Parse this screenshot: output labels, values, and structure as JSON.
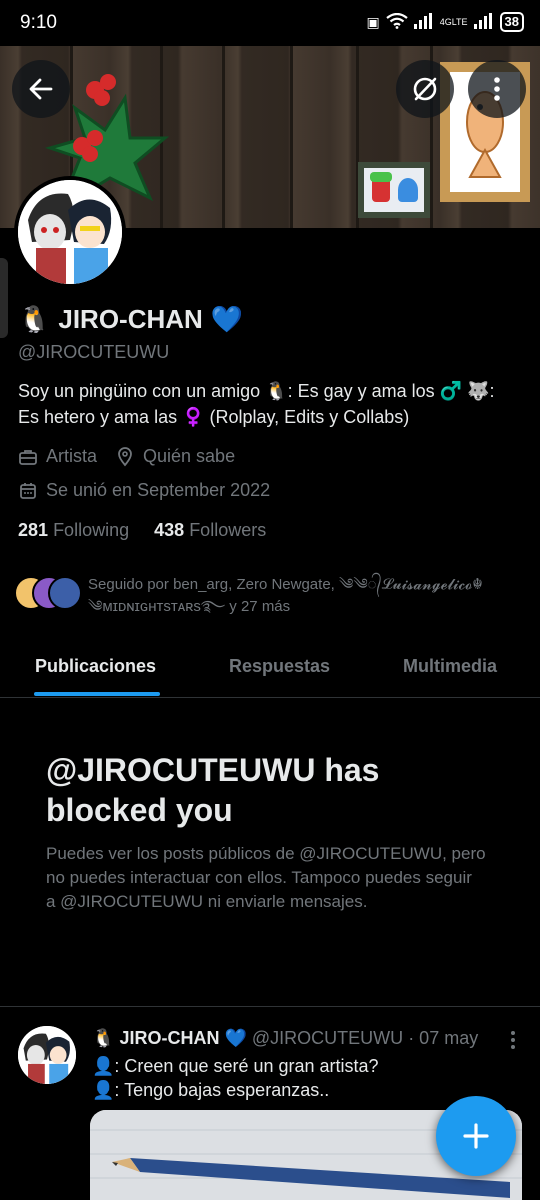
{
  "status_bar": {
    "time": "9:10",
    "network": "4GLTE",
    "battery": "38"
  },
  "profile": {
    "display_name": "JIRO-CHAN",
    "name_prefix_emoji": "🐧",
    "name_suffix_emoji": "💙",
    "handle": "@JIROCUTEUWU",
    "bio": "Soy un pingüino con un amigo 🐧: Es gay y ama los ♂️ 🐺: Es hetero y ama las ♀️ (Rolplay, Edits y Collabs)",
    "occupation": "Artista",
    "location": "Quién sabe",
    "joined": "Se unió en September 2022",
    "following_count": "281",
    "following_label": "Following",
    "followers_count": "438",
    "followers_label": "Followers",
    "followed_by": "Seguido por ben_arg, Zero Newgate, ༄༄᭄𝓛𝓾𝓲𝓼𝓪𝓷𝓰𝓮𝓵𝓲𝓬𝓸☬ ༄ᴍɪᴅɴɪɢʜᴛsᴛᴀʀs࿐ y 27 más"
  },
  "tabs": [
    {
      "label": "Publicaciones",
      "active": true
    },
    {
      "label": "Respuestas",
      "active": false
    },
    {
      "label": "Multimedia",
      "active": false
    }
  ],
  "blocked": {
    "title": "@JIROCUTEUWU has blocked you",
    "description": "Puedes ver los posts públicos de @JIROCUTEUWU, pero no puedes interactuar con ellos. Tampoco puedes seguir a @JIROCUTEUWU ni enviarle mensajes."
  },
  "post": {
    "author_emoji": "🐧",
    "author": "JIRO-CHAN",
    "author_suffix": "💙",
    "handle": "@JIROCUTEUWU",
    "date": "· 07 may",
    "line1": "👤: Creen que seré un gran artista?",
    "line2": "👤: Tengo bajas esperanzas.."
  },
  "colors": {
    "accent": "#1d9bf0",
    "background": "#000000",
    "secondary_text": "#71767b"
  },
  "icons": [
    "back-arrow-icon",
    "grok-icon",
    "more-vertical-icon",
    "briefcase-icon",
    "location-pin-icon",
    "calendar-icon",
    "plus-icon"
  ]
}
